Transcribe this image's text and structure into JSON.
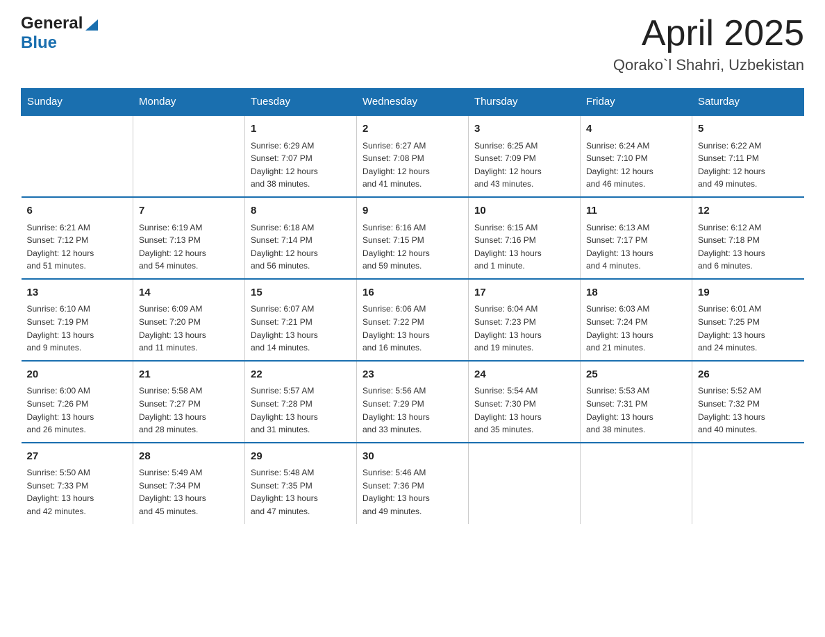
{
  "header": {
    "logo_general": "General",
    "logo_blue": "Blue",
    "month": "April 2025",
    "location": "Qorako`l Shahri, Uzbekistan"
  },
  "calendar": {
    "days_of_week": [
      "Sunday",
      "Monday",
      "Tuesday",
      "Wednesday",
      "Thursday",
      "Friday",
      "Saturday"
    ],
    "weeks": [
      [
        {
          "day": "",
          "info": ""
        },
        {
          "day": "",
          "info": ""
        },
        {
          "day": "1",
          "info": "Sunrise: 6:29 AM\nSunset: 7:07 PM\nDaylight: 12 hours\nand 38 minutes."
        },
        {
          "day": "2",
          "info": "Sunrise: 6:27 AM\nSunset: 7:08 PM\nDaylight: 12 hours\nand 41 minutes."
        },
        {
          "day": "3",
          "info": "Sunrise: 6:25 AM\nSunset: 7:09 PM\nDaylight: 12 hours\nand 43 minutes."
        },
        {
          "day": "4",
          "info": "Sunrise: 6:24 AM\nSunset: 7:10 PM\nDaylight: 12 hours\nand 46 minutes."
        },
        {
          "day": "5",
          "info": "Sunrise: 6:22 AM\nSunset: 7:11 PM\nDaylight: 12 hours\nand 49 minutes."
        }
      ],
      [
        {
          "day": "6",
          "info": "Sunrise: 6:21 AM\nSunset: 7:12 PM\nDaylight: 12 hours\nand 51 minutes."
        },
        {
          "day": "7",
          "info": "Sunrise: 6:19 AM\nSunset: 7:13 PM\nDaylight: 12 hours\nand 54 minutes."
        },
        {
          "day": "8",
          "info": "Sunrise: 6:18 AM\nSunset: 7:14 PM\nDaylight: 12 hours\nand 56 minutes."
        },
        {
          "day": "9",
          "info": "Sunrise: 6:16 AM\nSunset: 7:15 PM\nDaylight: 12 hours\nand 59 minutes."
        },
        {
          "day": "10",
          "info": "Sunrise: 6:15 AM\nSunset: 7:16 PM\nDaylight: 13 hours\nand 1 minute."
        },
        {
          "day": "11",
          "info": "Sunrise: 6:13 AM\nSunset: 7:17 PM\nDaylight: 13 hours\nand 4 minutes."
        },
        {
          "day": "12",
          "info": "Sunrise: 6:12 AM\nSunset: 7:18 PM\nDaylight: 13 hours\nand 6 minutes."
        }
      ],
      [
        {
          "day": "13",
          "info": "Sunrise: 6:10 AM\nSunset: 7:19 PM\nDaylight: 13 hours\nand 9 minutes."
        },
        {
          "day": "14",
          "info": "Sunrise: 6:09 AM\nSunset: 7:20 PM\nDaylight: 13 hours\nand 11 minutes."
        },
        {
          "day": "15",
          "info": "Sunrise: 6:07 AM\nSunset: 7:21 PM\nDaylight: 13 hours\nand 14 minutes."
        },
        {
          "day": "16",
          "info": "Sunrise: 6:06 AM\nSunset: 7:22 PM\nDaylight: 13 hours\nand 16 minutes."
        },
        {
          "day": "17",
          "info": "Sunrise: 6:04 AM\nSunset: 7:23 PM\nDaylight: 13 hours\nand 19 minutes."
        },
        {
          "day": "18",
          "info": "Sunrise: 6:03 AM\nSunset: 7:24 PM\nDaylight: 13 hours\nand 21 minutes."
        },
        {
          "day": "19",
          "info": "Sunrise: 6:01 AM\nSunset: 7:25 PM\nDaylight: 13 hours\nand 24 minutes."
        }
      ],
      [
        {
          "day": "20",
          "info": "Sunrise: 6:00 AM\nSunset: 7:26 PM\nDaylight: 13 hours\nand 26 minutes."
        },
        {
          "day": "21",
          "info": "Sunrise: 5:58 AM\nSunset: 7:27 PM\nDaylight: 13 hours\nand 28 minutes."
        },
        {
          "day": "22",
          "info": "Sunrise: 5:57 AM\nSunset: 7:28 PM\nDaylight: 13 hours\nand 31 minutes."
        },
        {
          "day": "23",
          "info": "Sunrise: 5:56 AM\nSunset: 7:29 PM\nDaylight: 13 hours\nand 33 minutes."
        },
        {
          "day": "24",
          "info": "Sunrise: 5:54 AM\nSunset: 7:30 PM\nDaylight: 13 hours\nand 35 minutes."
        },
        {
          "day": "25",
          "info": "Sunrise: 5:53 AM\nSunset: 7:31 PM\nDaylight: 13 hours\nand 38 minutes."
        },
        {
          "day": "26",
          "info": "Sunrise: 5:52 AM\nSunset: 7:32 PM\nDaylight: 13 hours\nand 40 minutes."
        }
      ],
      [
        {
          "day": "27",
          "info": "Sunrise: 5:50 AM\nSunset: 7:33 PM\nDaylight: 13 hours\nand 42 minutes."
        },
        {
          "day": "28",
          "info": "Sunrise: 5:49 AM\nSunset: 7:34 PM\nDaylight: 13 hours\nand 45 minutes."
        },
        {
          "day": "29",
          "info": "Sunrise: 5:48 AM\nSunset: 7:35 PM\nDaylight: 13 hours\nand 47 minutes."
        },
        {
          "day": "30",
          "info": "Sunrise: 5:46 AM\nSunset: 7:36 PM\nDaylight: 13 hours\nand 49 minutes."
        },
        {
          "day": "",
          "info": ""
        },
        {
          "day": "",
          "info": ""
        },
        {
          "day": "",
          "info": ""
        }
      ]
    ]
  }
}
